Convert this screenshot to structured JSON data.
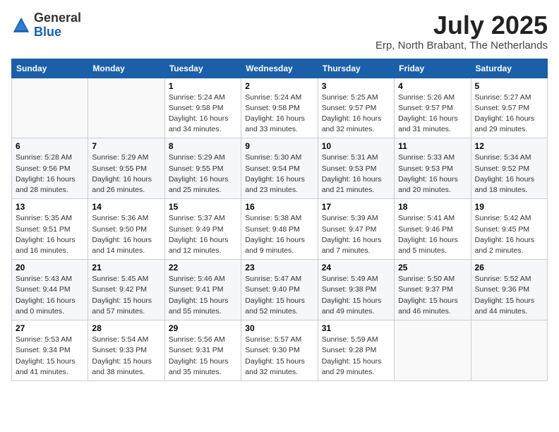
{
  "logo": {
    "general": "General",
    "blue": "Blue"
  },
  "title": "July 2025",
  "location": "Erp, North Brabant, The Netherlands",
  "days_of_week": [
    "Sunday",
    "Monday",
    "Tuesday",
    "Wednesday",
    "Thursday",
    "Friday",
    "Saturday"
  ],
  "weeks": [
    [
      {
        "day": "",
        "info": ""
      },
      {
        "day": "",
        "info": ""
      },
      {
        "day": "1",
        "info": "Sunrise: 5:24 AM\nSunset: 9:58 PM\nDaylight: 16 hours and 34 minutes."
      },
      {
        "day": "2",
        "info": "Sunrise: 5:24 AM\nSunset: 9:58 PM\nDaylight: 16 hours and 33 minutes."
      },
      {
        "day": "3",
        "info": "Sunrise: 5:25 AM\nSunset: 9:57 PM\nDaylight: 16 hours and 32 minutes."
      },
      {
        "day": "4",
        "info": "Sunrise: 5:26 AM\nSunset: 9:57 PM\nDaylight: 16 hours and 31 minutes."
      },
      {
        "day": "5",
        "info": "Sunrise: 5:27 AM\nSunset: 9:57 PM\nDaylight: 16 hours and 29 minutes."
      }
    ],
    [
      {
        "day": "6",
        "info": "Sunrise: 5:28 AM\nSunset: 9:56 PM\nDaylight: 16 hours and 28 minutes."
      },
      {
        "day": "7",
        "info": "Sunrise: 5:29 AM\nSunset: 9:55 PM\nDaylight: 16 hours and 26 minutes."
      },
      {
        "day": "8",
        "info": "Sunrise: 5:29 AM\nSunset: 9:55 PM\nDaylight: 16 hours and 25 minutes."
      },
      {
        "day": "9",
        "info": "Sunrise: 5:30 AM\nSunset: 9:54 PM\nDaylight: 16 hours and 23 minutes."
      },
      {
        "day": "10",
        "info": "Sunrise: 5:31 AM\nSunset: 9:53 PM\nDaylight: 16 hours and 21 minutes."
      },
      {
        "day": "11",
        "info": "Sunrise: 5:33 AM\nSunset: 9:53 PM\nDaylight: 16 hours and 20 minutes."
      },
      {
        "day": "12",
        "info": "Sunrise: 5:34 AM\nSunset: 9:52 PM\nDaylight: 16 hours and 18 minutes."
      }
    ],
    [
      {
        "day": "13",
        "info": "Sunrise: 5:35 AM\nSunset: 9:51 PM\nDaylight: 16 hours and 16 minutes."
      },
      {
        "day": "14",
        "info": "Sunrise: 5:36 AM\nSunset: 9:50 PM\nDaylight: 16 hours and 14 minutes."
      },
      {
        "day": "15",
        "info": "Sunrise: 5:37 AM\nSunset: 9:49 PM\nDaylight: 16 hours and 12 minutes."
      },
      {
        "day": "16",
        "info": "Sunrise: 5:38 AM\nSunset: 9:48 PM\nDaylight: 16 hours and 9 minutes."
      },
      {
        "day": "17",
        "info": "Sunrise: 5:39 AM\nSunset: 9:47 PM\nDaylight: 16 hours and 7 minutes."
      },
      {
        "day": "18",
        "info": "Sunrise: 5:41 AM\nSunset: 9:46 PM\nDaylight: 16 hours and 5 minutes."
      },
      {
        "day": "19",
        "info": "Sunrise: 5:42 AM\nSunset: 9:45 PM\nDaylight: 16 hours and 2 minutes."
      }
    ],
    [
      {
        "day": "20",
        "info": "Sunrise: 5:43 AM\nSunset: 9:44 PM\nDaylight: 16 hours and 0 minutes."
      },
      {
        "day": "21",
        "info": "Sunrise: 5:45 AM\nSunset: 9:42 PM\nDaylight: 15 hours and 57 minutes."
      },
      {
        "day": "22",
        "info": "Sunrise: 5:46 AM\nSunset: 9:41 PM\nDaylight: 15 hours and 55 minutes."
      },
      {
        "day": "23",
        "info": "Sunrise: 5:47 AM\nSunset: 9:40 PM\nDaylight: 15 hours and 52 minutes."
      },
      {
        "day": "24",
        "info": "Sunrise: 5:49 AM\nSunset: 9:38 PM\nDaylight: 15 hours and 49 minutes."
      },
      {
        "day": "25",
        "info": "Sunrise: 5:50 AM\nSunset: 9:37 PM\nDaylight: 15 hours and 46 minutes."
      },
      {
        "day": "26",
        "info": "Sunrise: 5:52 AM\nSunset: 9:36 PM\nDaylight: 15 hours and 44 minutes."
      }
    ],
    [
      {
        "day": "27",
        "info": "Sunrise: 5:53 AM\nSunset: 9:34 PM\nDaylight: 15 hours and 41 minutes."
      },
      {
        "day": "28",
        "info": "Sunrise: 5:54 AM\nSunset: 9:33 PM\nDaylight: 15 hours and 38 minutes."
      },
      {
        "day": "29",
        "info": "Sunrise: 5:56 AM\nSunset: 9:31 PM\nDaylight: 15 hours and 35 minutes."
      },
      {
        "day": "30",
        "info": "Sunrise: 5:57 AM\nSunset: 9:30 PM\nDaylight: 15 hours and 32 minutes."
      },
      {
        "day": "31",
        "info": "Sunrise: 5:59 AM\nSunset: 9:28 PM\nDaylight: 15 hours and 29 minutes."
      },
      {
        "day": "",
        "info": ""
      },
      {
        "day": "",
        "info": ""
      }
    ]
  ]
}
